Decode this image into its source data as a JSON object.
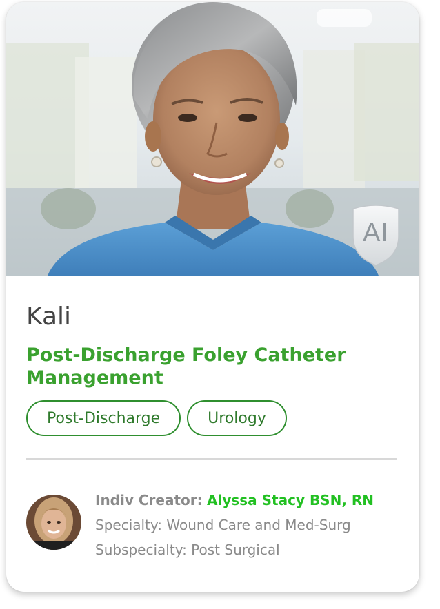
{
  "card": {
    "ai_badge": "AI",
    "name": "Kali",
    "title": "Post-Discharge Foley Catheter Management",
    "tags": [
      "Post-Discharge",
      "Urology"
    ],
    "creator": {
      "label": "Indiv Creator:",
      "name": "Alyssa Stacy BSN, RN",
      "specialty": "Specialty: Wound Care and Med-Surg",
      "subspecialty": "Subspecialty: Post Surgical"
    }
  },
  "colors": {
    "title_green": "#3aa12f",
    "creator_green": "#22c022",
    "tag_border": "#2f8f2f",
    "scrubs_blue": "#4f8fc9"
  }
}
